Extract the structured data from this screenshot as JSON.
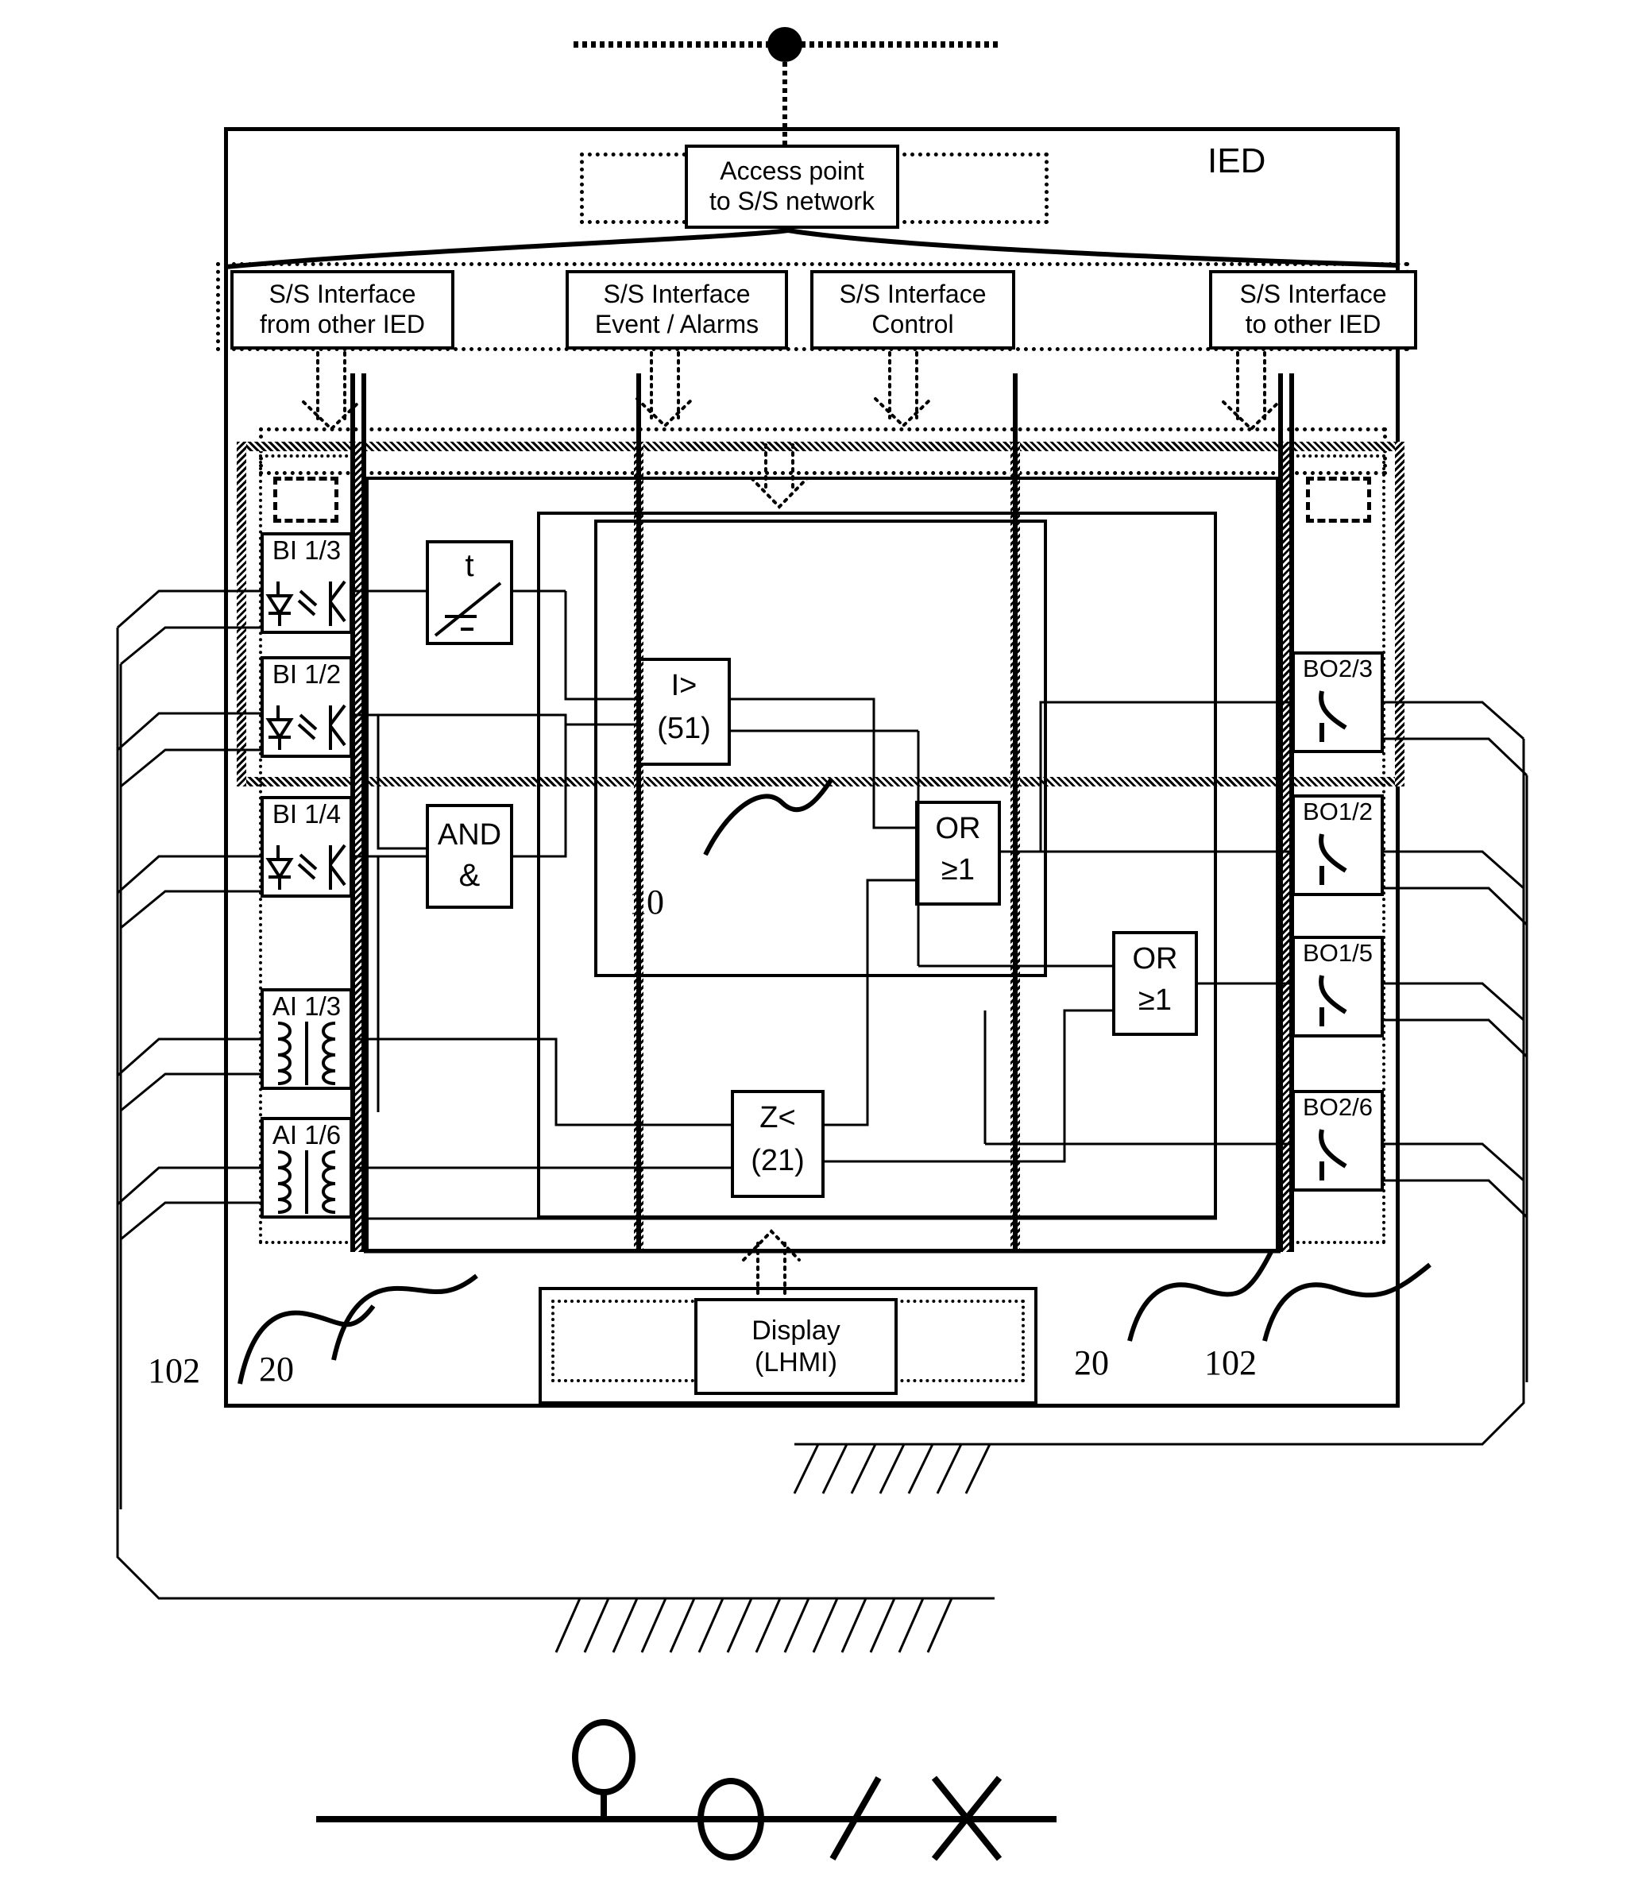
{
  "diagram": {
    "title": "IED",
    "device_label": "IED",
    "access_point": {
      "line1": "Access point",
      "line2": "to S/S network"
    },
    "display": {
      "line1": "Display",
      "line2": "(LHMI)"
    },
    "interfaces": [
      {
        "id": "ss-from-other-ied",
        "line1": "S/S Interface",
        "line2": "from other IED"
      },
      {
        "id": "ss-event-alarms",
        "line1": "S/S Interface",
        "line2": "Event / Alarms"
      },
      {
        "id": "ss-control",
        "line1": "S/S Interface",
        "line2": "Control"
      },
      {
        "id": "ss-to-other-ied",
        "line1": "S/S Interface",
        "line2": "to other IED"
      }
    ],
    "binary_inputs": [
      {
        "id": "bi-1-3",
        "label": "BI 1/3",
        "symbol": "opto-isolator-icon"
      },
      {
        "id": "bi-1-2",
        "label": "BI 1/2",
        "symbol": "opto-isolator-icon"
      },
      {
        "id": "bi-1-4",
        "label": "BI 1/4",
        "symbol": "opto-isolator-icon"
      }
    ],
    "analog_inputs": [
      {
        "id": "ai-1-3",
        "label": "AI 1/3",
        "symbol": "transformer-icon"
      },
      {
        "id": "ai-1-6",
        "label": "AI 1/6",
        "symbol": "transformer-icon"
      }
    ],
    "binary_outputs": [
      {
        "id": "bo-2-3",
        "label": "BO2/3",
        "symbol": "relay-contact-icon"
      },
      {
        "id": "bo-1-2",
        "label": "BO1/2",
        "symbol": "relay-contact-icon"
      },
      {
        "id": "bo-1-5",
        "label": "BO1/5",
        "symbol": "relay-contact-icon"
      },
      {
        "id": "bo-2-6",
        "label": "BO2/6",
        "symbol": "relay-contact-icon"
      }
    ],
    "function_blocks": [
      {
        "id": "timer",
        "line1": "t",
        "line2": "",
        "symbol": "timer-icon"
      },
      {
        "id": "and-gate",
        "line1": "AND",
        "line2": "&",
        "symbol": "and-gate-icon"
      },
      {
        "id": "overcurrent",
        "line1": "I>",
        "line2": "(51)",
        "symbol": "overcurrent-icon"
      },
      {
        "id": "distance",
        "line1": "Z<",
        "line2": "(21)",
        "symbol": "distance-icon"
      },
      {
        "id": "or-gate-1",
        "line1": "OR",
        "line2": "≥1",
        "symbol": "or-gate-icon"
      },
      {
        "id": "or-gate-2",
        "line1": "OR",
        "line2": "≥1",
        "symbol": "or-gate-icon"
      }
    ],
    "reference_numerals": [
      {
        "id": "ref-10",
        "value": "10"
      },
      {
        "id": "ref-102-left",
        "value": "102"
      },
      {
        "id": "ref-20-left",
        "value": "20"
      },
      {
        "id": "ref-20-right",
        "value": "20"
      },
      {
        "id": "ref-102-right",
        "value": "102"
      }
    ],
    "single_line": {
      "items": [
        {
          "id": "voltage-transformer-icon",
          "name": "voltage-transformer"
        },
        {
          "id": "current-transformer-icon",
          "name": "current-transformer"
        },
        {
          "id": "disconnector-icon",
          "name": "disconnector"
        },
        {
          "id": "circuit-breaker-icon",
          "name": "circuit-breaker"
        }
      ]
    },
    "colors": {
      "ink": "#000000",
      "paper": "#ffffff"
    }
  }
}
